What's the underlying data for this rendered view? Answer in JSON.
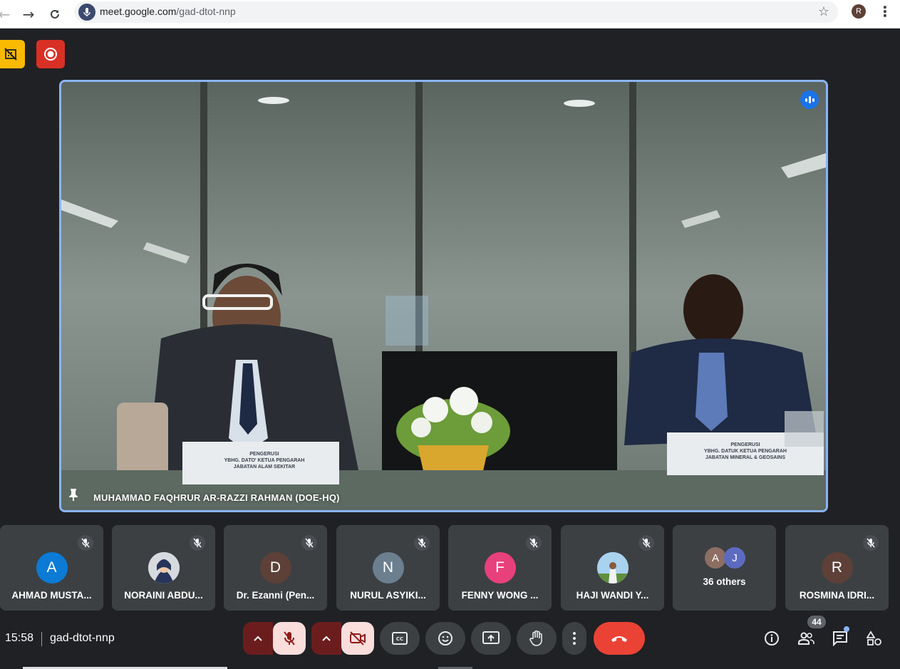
{
  "browser": {
    "url_host": "meet.google.com",
    "url_path": "/gad-dtot-nnp",
    "profile_initial": "R"
  },
  "main_video": {
    "speaker_name": "MUHAMMAD FAQHRUR AR-RAZZI RAHMAN (DOE-HQ)",
    "nameplate_left": "PENGERUSI\nYBHG. DATO' KETUA PENGARAH\nJABATAN ALAM SEKITAR",
    "nameplate_right": "PENGERUSI\nYBHG. DATUK KETUA PENGARAH\nJABATAN MINERAL & GEOSAINS"
  },
  "participants": [
    {
      "initial": "A",
      "name": "AHMAD MUSTA...",
      "color": "#0b7bd6"
    },
    {
      "initial": "",
      "name": "NORAINI ABDU...",
      "color": "#c7ccd2"
    },
    {
      "initial": "D",
      "name": "Dr. Ezanni (Pen...",
      "color": "#5d4037"
    },
    {
      "initial": "N",
      "name": "NURUL ASYIKI...",
      "color": "#6b7f8f"
    },
    {
      "initial": "F",
      "name": "FENNY WONG ...",
      "color": "#e8407a"
    },
    {
      "initial": "",
      "name": "HAJI WANDI Y...",
      "color": "#9ecbe8"
    },
    {
      "initial": "",
      "name": "",
      "color": ""
    },
    {
      "initial": "R",
      "name": "ROSMINA IDRI...",
      "color": "#5d4037"
    }
  ],
  "others": {
    "label": "36 others",
    "a_initial": "A",
    "a_color": "#8d6e63",
    "j_initial": "J",
    "j_color": "#5c6bc0"
  },
  "meeting": {
    "time": "15:58",
    "code": "gad-dtot-nnp",
    "participant_count": "44"
  },
  "colors": {
    "accent": "#8ab4f8",
    "end_call": "#ea4335",
    "muted_bg": "#f9dedc",
    "muted_icon": "#8c1d18"
  }
}
